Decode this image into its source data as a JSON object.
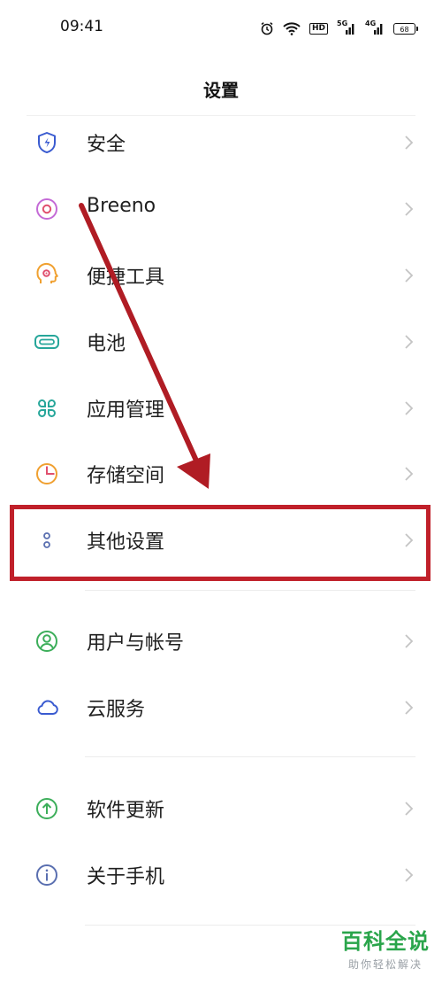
{
  "status_bar": {
    "time": "09:41",
    "hd": "HD",
    "net1": "5G",
    "net2": "4G",
    "battery": "68",
    "icons": [
      "alarm-icon",
      "wifi-icon",
      "hd-icon",
      "signal-5g-icon",
      "signal-4g-icon",
      "battery-icon"
    ]
  },
  "header": {
    "title": "设置"
  },
  "settings": [
    {
      "label": "安全",
      "icon": "shield-icon",
      "color": "#3a5bd0"
    },
    {
      "label": "Breeno",
      "icon": "breeno-icon",
      "color": "#c46ad6"
    },
    {
      "label": "便捷工具",
      "icon": "head-gear-icon",
      "color": "#f0a030"
    },
    {
      "label": "电池",
      "icon": "battery-outline-icon",
      "color": "#26a69a"
    },
    {
      "label": "应用管理",
      "icon": "apps-icon",
      "color": "#26a69a"
    },
    {
      "label": "存储空间",
      "icon": "pie-icon",
      "color": "#f0a030"
    },
    {
      "label": "其他设置",
      "icon": "more-dots-icon",
      "color": "#5a6fb0"
    },
    {
      "label": "用户与帐号",
      "icon": "user-icon",
      "color": "#3cae5a"
    },
    {
      "label": "云服务",
      "icon": "cloud-icon",
      "color": "#3a5bd0"
    },
    {
      "label": "软件更新",
      "icon": "update-icon",
      "color": "#3cae5a"
    },
    {
      "label": "关于手机",
      "icon": "info-icon",
      "color": "#5a6fb0"
    }
  ],
  "annotation": {
    "highlight_color": "#c0202a"
  },
  "watermark": {
    "title": "百科全说",
    "subtitle": "助你轻松解决"
  }
}
